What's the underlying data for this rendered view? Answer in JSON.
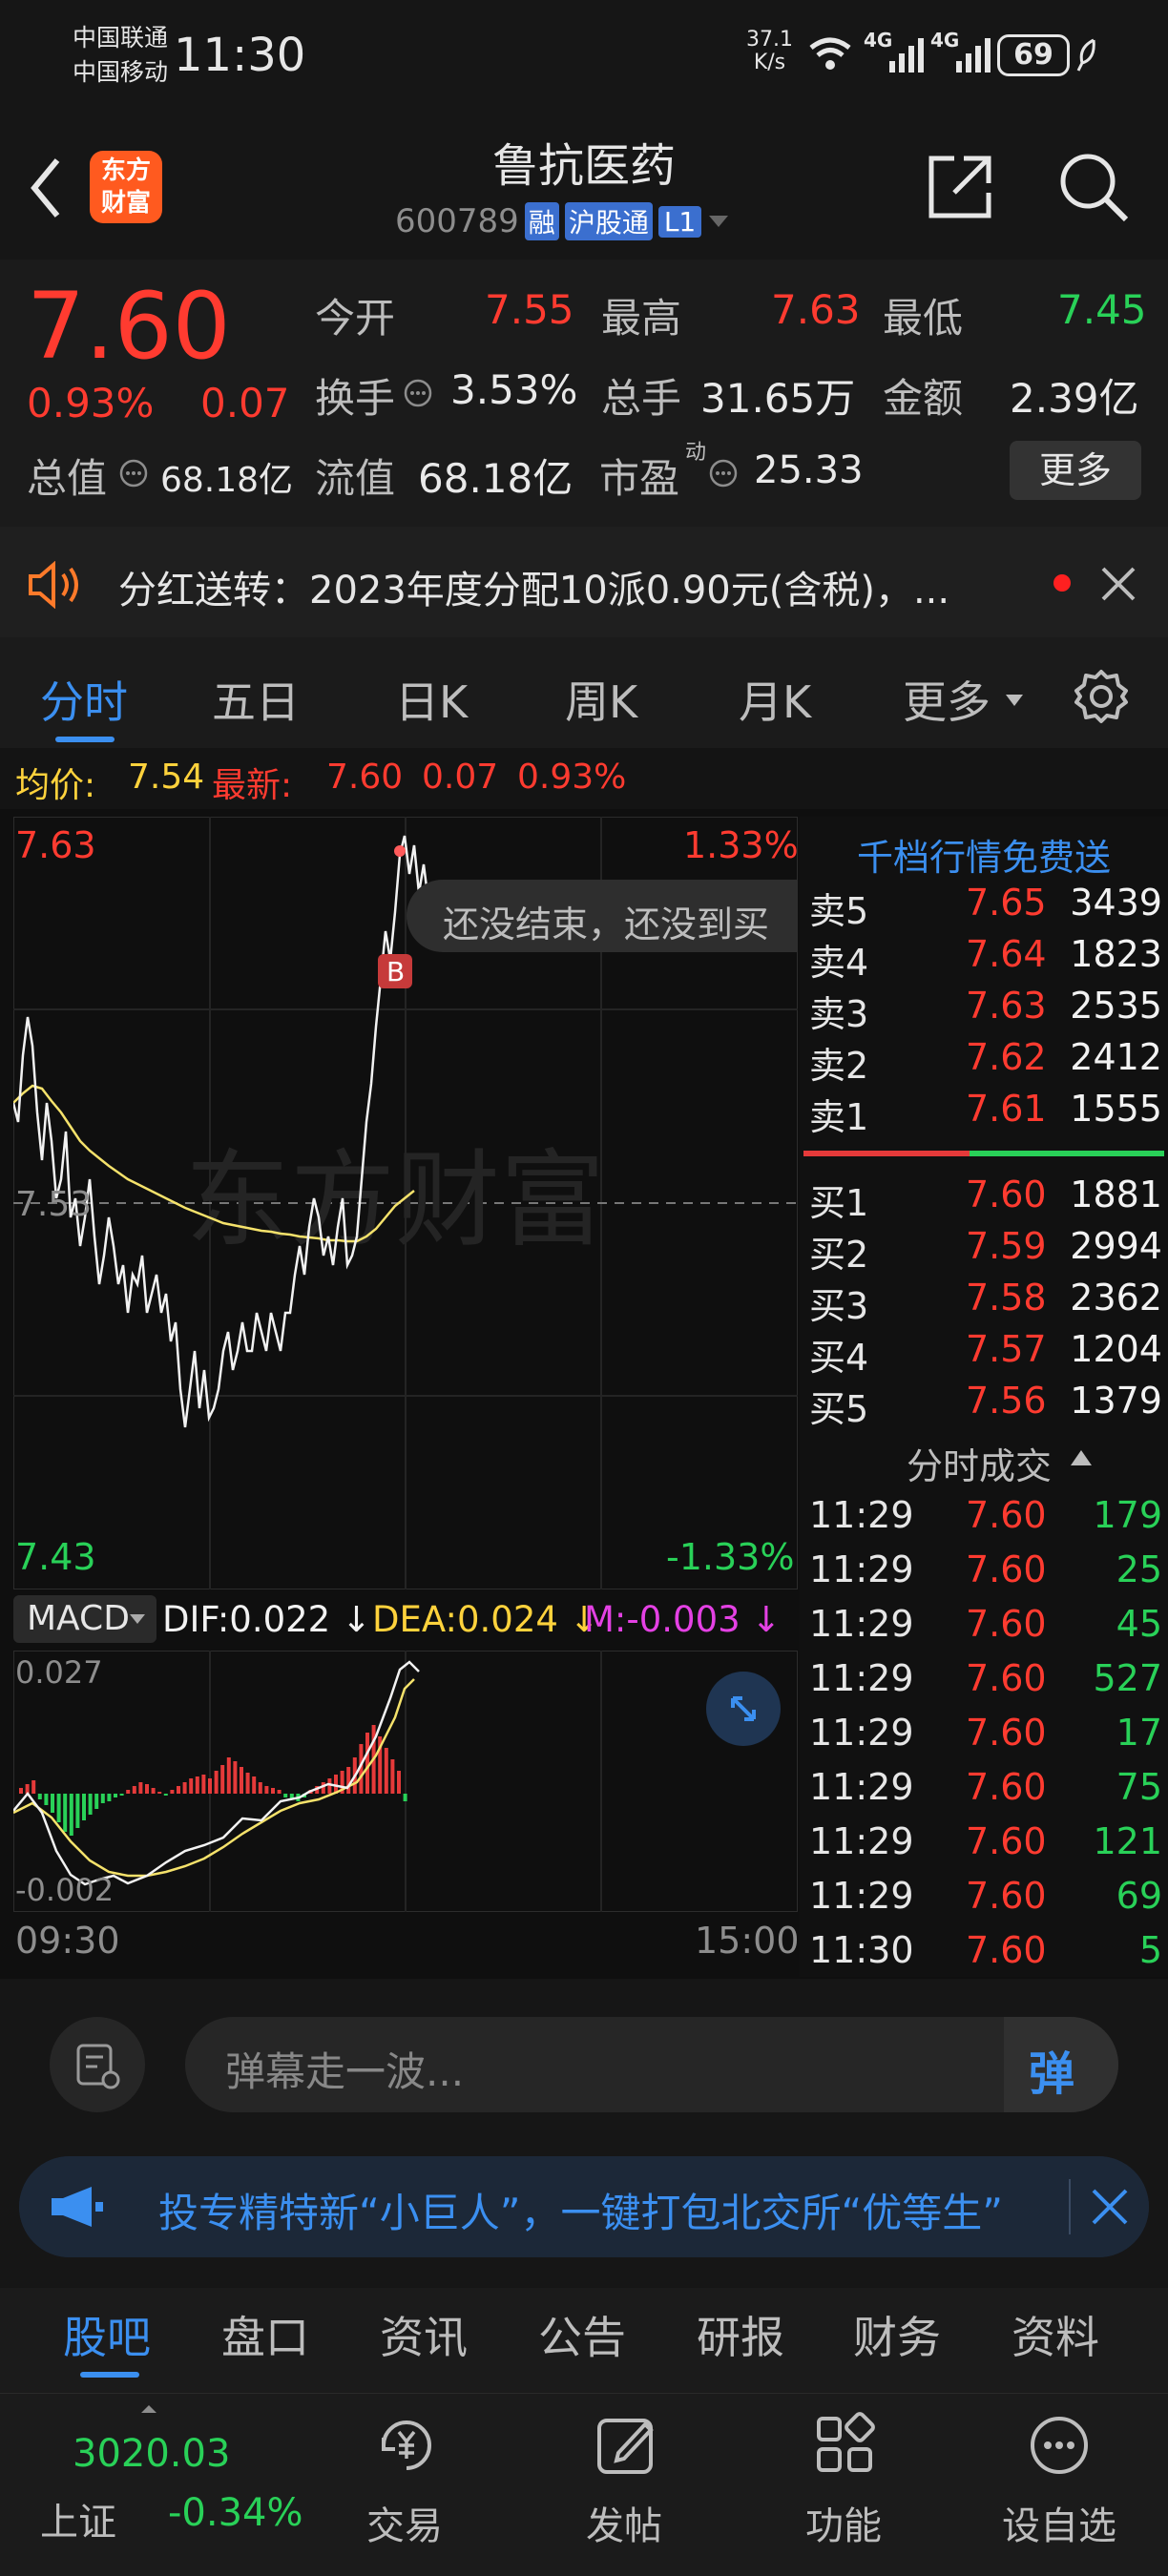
{
  "status": {
    "carrier1": "中国联通",
    "carrier2": "中国移动",
    "time": "11:30",
    "speed_top": "37.1",
    "speed_bottom": "K/s",
    "net1": "4G",
    "net2": "4G",
    "battery": "69"
  },
  "nav": {
    "logo_top": "东方",
    "logo_bottom": "财富",
    "title": "鲁抗医药",
    "code": "600789",
    "tag1": "融",
    "tag2": "沪股通",
    "tag3": "L1"
  },
  "quote": {
    "price": "7.60",
    "pct": "0.93%",
    "chg": "0.07",
    "open_label": "今开",
    "open": "7.55",
    "high_label": "最高",
    "high": "7.63",
    "low_label": "最低",
    "low": "7.45",
    "turn_label": "换手",
    "turn": "3.53%",
    "vol_label": "总手",
    "vol": "31.65万",
    "amt_label": "金额",
    "amt": "2.39亿",
    "mcap_label": "总值",
    "mcap": "68.18亿",
    "float_label": "流值",
    "float": "68.18亿",
    "pe_label": "市盈",
    "pe_sup": "动",
    "pe": "25.33",
    "more": "更多"
  },
  "notice": {
    "text": "分红送转：2023年度分配10派0.90元(含税)，..."
  },
  "tabs": [
    "分时",
    "五日",
    "日K",
    "周K",
    "月K",
    "更多"
  ],
  "info": {
    "avg_label": "均价:",
    "avg": "7.54",
    "latest_label": "最新:",
    "latest": "7.60",
    "chg": "0.07",
    "pct": "0.93%"
  },
  "chart": {
    "ymax": "7.63",
    "ymin": "7.43",
    "pmax": "1.33%",
    "pmin": "-1.33%",
    "mid": "7.53",
    "t0": "09:30",
    "t1": "15:00",
    "watermark": "东方财富",
    "bubble": "还没结束，还没到买",
    "marker": "B"
  },
  "macd": {
    "name": "MACD",
    "dif": "DIF:0.022",
    "dea": "DEA:0.024",
    "m": "M:-0.003",
    "top": "0.027",
    "bottom": "-0.002"
  },
  "orderbook": {
    "promo": "千档行情免费送",
    "asks": [
      {
        "l": "卖5",
        "p": "7.65",
        "v": "3439"
      },
      {
        "l": "卖4",
        "p": "7.64",
        "v": "1823"
      },
      {
        "l": "卖3",
        "p": "7.63",
        "v": "2535"
      },
      {
        "l": "卖2",
        "p": "7.62",
        "v": "2412"
      },
      {
        "l": "卖1",
        "p": "7.61",
        "v": "1555"
      }
    ],
    "bids": [
      {
        "l": "买1",
        "p": "7.60",
        "v": "1881"
      },
      {
        "l": "买2",
        "p": "7.59",
        "v": "2994"
      },
      {
        "l": "买3",
        "p": "7.58",
        "v": "2362"
      },
      {
        "l": "买4",
        "p": "7.57",
        "v": "1204"
      },
      {
        "l": "买5",
        "p": "7.56",
        "v": "1379"
      }
    ]
  },
  "trades": {
    "title": "分时成交",
    "rows": [
      {
        "t": "11:29",
        "p": "7.60",
        "v": "179"
      },
      {
        "t": "11:29",
        "p": "7.60",
        "v": "25"
      },
      {
        "t": "11:29",
        "p": "7.60",
        "v": "45"
      },
      {
        "t": "11:29",
        "p": "7.60",
        "v": "527"
      },
      {
        "t": "11:29",
        "p": "7.60",
        "v": "17"
      },
      {
        "t": "11:29",
        "p": "7.60",
        "v": "75"
      },
      {
        "t": "11:29",
        "p": "7.60",
        "v": "121"
      },
      {
        "t": "11:29",
        "p": "7.60",
        "v": "69"
      },
      {
        "t": "11:30",
        "p": "7.60",
        "v": "5"
      }
    ]
  },
  "danmu": {
    "placeholder": "弹幕走一波...",
    "send": "弹",
    "ad": "投专精特新“小巨人”，一键打包北交所“优等生”"
  },
  "subtabs": [
    "股吧",
    "盘口",
    "资讯",
    "公告",
    "研报",
    "财务",
    "资料"
  ],
  "bottom": {
    "index_value": "3020.03",
    "index_name": "上证",
    "index_pct": "-0.34%",
    "items": [
      "交易",
      "发帖",
      "功能",
      "设自选"
    ]
  },
  "colors": {
    "up": "#ff3b30",
    "down": "#29d158",
    "accent": "#3b8ff0",
    "avg_line": "#f5e26b"
  }
}
